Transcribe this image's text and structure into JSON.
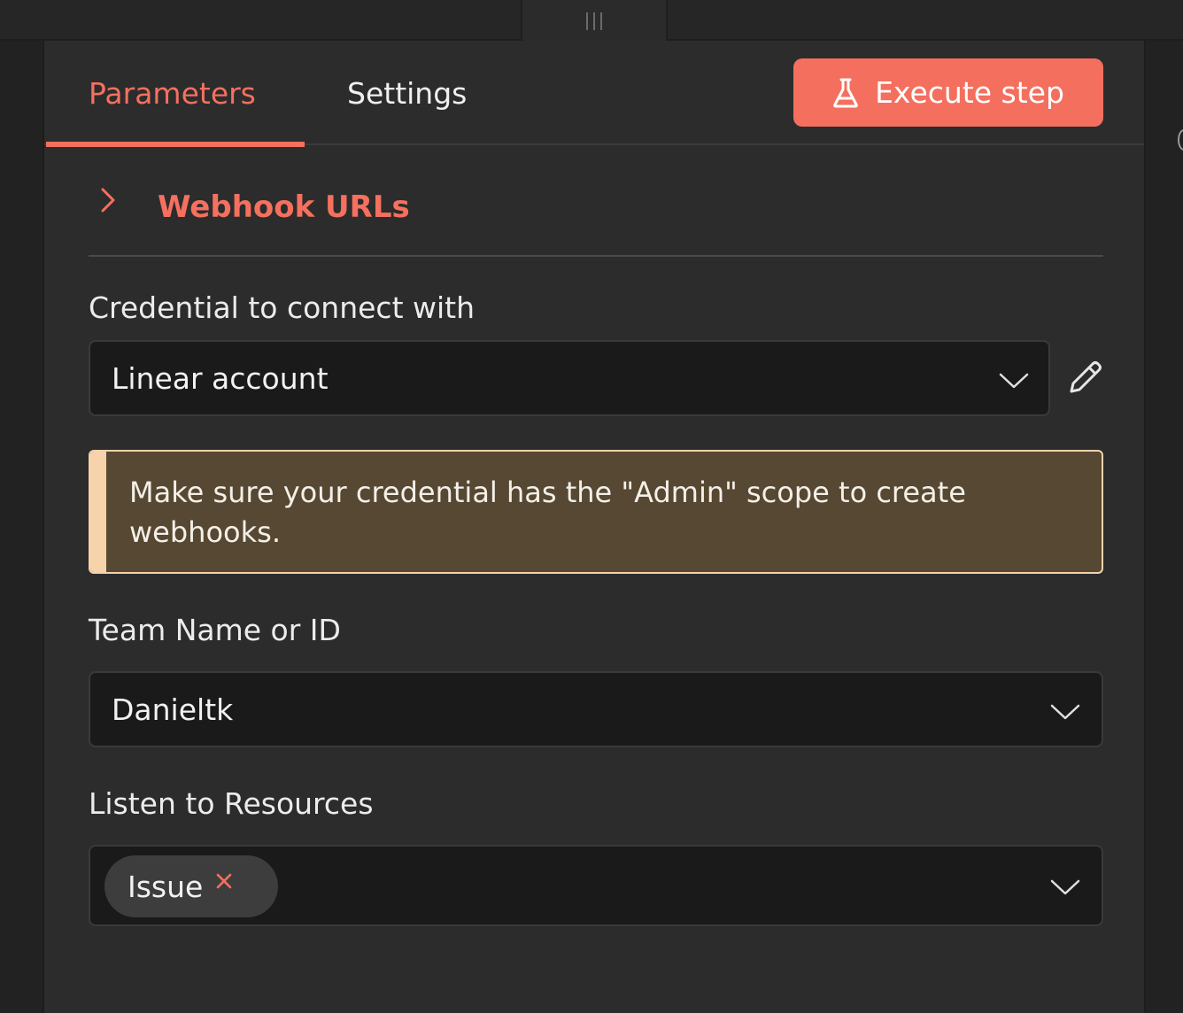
{
  "tabs": [
    {
      "label": "Parameters",
      "active": true
    },
    {
      "label": "Settings",
      "active": false
    }
  ],
  "execute_button": {
    "label": "Execute step",
    "icon": "flask-icon"
  },
  "section": {
    "title": "Webhook URLs",
    "icon": "chevron-right-icon"
  },
  "credential": {
    "label": "Credential to connect with",
    "value": "Linear account"
  },
  "notice": {
    "text": "Make sure your credential has the \"Admin\" scope to create webhooks."
  },
  "team": {
    "label": "Team Name or ID",
    "value": "Danieltk"
  },
  "resources": {
    "label": "Listen to Resources",
    "chips": [
      "Issue"
    ]
  },
  "colors": {
    "accent": "#f46f5e",
    "notice_background": "#564832",
    "notice_border": "#f5d2ac",
    "panel_background": "#2c2c2c",
    "input_background": "#1a1a1a"
  }
}
